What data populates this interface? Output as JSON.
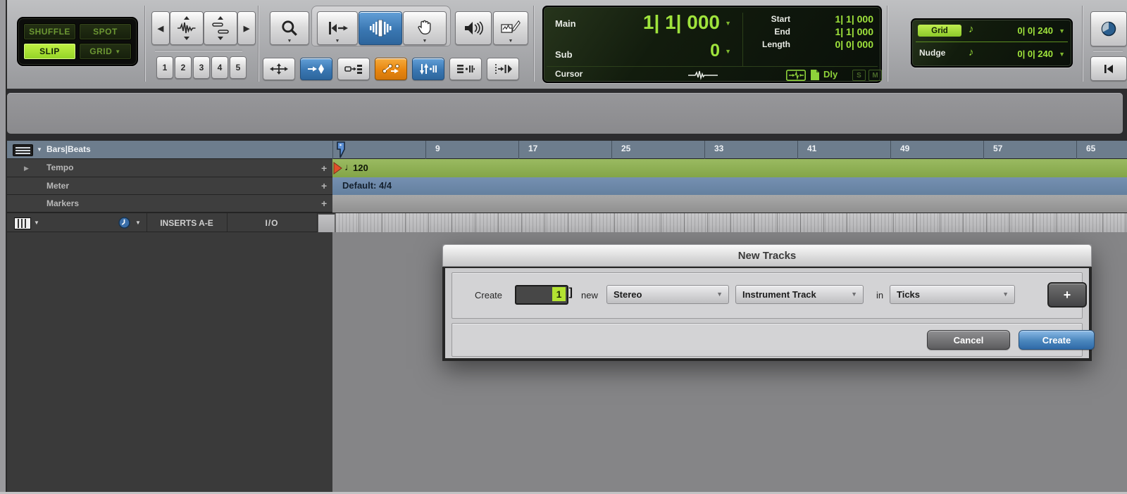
{
  "toolbar": {
    "edit_modes": {
      "shuffle": "SHUFFLE",
      "spot": "SPOT",
      "slip": "SLIP",
      "grid": "GRID"
    },
    "presets": [
      "1",
      "2",
      "3",
      "4",
      "5"
    ],
    "counter": {
      "main_label": "Main",
      "main_value": "1| 1| 000",
      "sub_label": "Sub",
      "sub_value": "0",
      "start_label": "Start",
      "start_value": "1| 1| 000",
      "end_label": "End",
      "end_value": "1| 1| 000",
      "length_label": "Length",
      "length_value": "0| 0| 000",
      "cursor_label": "Cursor",
      "dly_label": "Dly",
      "solo_label": "S",
      "mute_label": "M"
    },
    "grid_nudge": {
      "grid_label": "Grid",
      "grid_value": "0| 0| 240",
      "nudge_label": "Nudge",
      "nudge_value": "0| 0| 240",
      "note_glyph": "♪"
    }
  },
  "ruler": {
    "bars_beats_label": "Bars|Beats",
    "ticks": [
      "9",
      "17",
      "25",
      "33",
      "41",
      "49",
      "57",
      "65"
    ],
    "tempo_label": "Tempo",
    "tempo_note_glyph": "♩",
    "tempo_value": "120",
    "meter_label": "Meter",
    "meter_value": "Default: 4/4",
    "markers_label": "Markers",
    "add_button": "+"
  },
  "track_header": {
    "inserts_label": "INSERTS A-E",
    "io_label": "I/O"
  },
  "dialog": {
    "title": "New Tracks",
    "create_label": "Create",
    "count_value": "1",
    "new_label": "new",
    "format_value": "Stereo",
    "type_value": "Instrument Track",
    "in_label": "in",
    "timebase_value": "Ticks",
    "add_label": "+",
    "cancel_label": "Cancel",
    "create_button_label": "Create"
  },
  "colors": {
    "accent_green": "#9fe33c",
    "active_blue": "#3a77b2",
    "active_orange": "#e8860f",
    "tempo_green": "#8fb054",
    "meter_blue": "#6d89ab",
    "ruler_bluegray": "#6d7d8d"
  }
}
